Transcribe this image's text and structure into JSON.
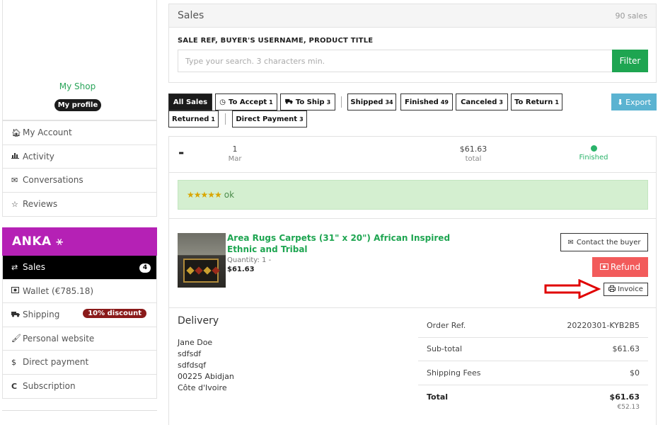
{
  "sidebar": {
    "shop_link": "My Shop",
    "profile_badge": "My profile",
    "account_items": [
      {
        "label": "My Account",
        "icon": "home-icon"
      },
      {
        "label": "Activity",
        "icon": "bar-chart-icon"
      },
      {
        "label": "Conversations",
        "icon": "envelope-icon"
      },
      {
        "label": "Reviews",
        "icon": "star-icon"
      }
    ],
    "brand": "ANKA",
    "shop_items": [
      {
        "label": "Sales",
        "icon": "exchange-icon",
        "badge": "4",
        "active": true
      },
      {
        "label": "Wallet (€785.18)",
        "icon": "wallet-icon"
      },
      {
        "label": "Shipping",
        "icon": "truck-icon",
        "badge": "10% discount"
      },
      {
        "label": "Personal website",
        "icon": "brush-icon"
      },
      {
        "label": "Direct payment",
        "icon": "dollar-icon"
      },
      {
        "label": "Subscription",
        "icon": "refresh-icon"
      }
    ]
  },
  "sales": {
    "title": "Sales",
    "count": "90 sales",
    "search_label": "SALE REF, BUYER'S USERNAME, PRODUCT TITLE",
    "search_placeholder": "Type your search. 3 characters min.",
    "filter_button": "Filter"
  },
  "filters": [
    {
      "label": "All Sales",
      "count": ""
    },
    {
      "label": "To Accept",
      "count": "1"
    },
    {
      "label": "To Ship",
      "count": "3"
    },
    {
      "label": "Shipped",
      "count": "34"
    },
    {
      "label": "Finished",
      "count": "49"
    },
    {
      "label": "Canceled",
      "count": "3"
    },
    {
      "label": "To Return",
      "count": "1"
    },
    {
      "label": "Returned",
      "count": "1"
    },
    {
      "label": "Direct Payment",
      "count": "3"
    }
  ],
  "export_button": "Export",
  "order": {
    "collapse": "-",
    "day": "1",
    "month": "Mar",
    "amount": "$61.63",
    "amount_label": "total",
    "status": "Finished",
    "status_color": "#2ab36a",
    "review_stars": "★★★★★",
    "review_text": "ok",
    "product_title": "Area Rugs Carpets (31\" x 20\") African Inspired Ethnic and Tribal",
    "quantity": "Quantity: 1 -",
    "price": "$61.63",
    "contact_button": "Contact the buyer",
    "refund_button": "Refund",
    "invoice_button": "Invoice"
  },
  "delivery": {
    "title": "Delivery",
    "address_lines": [
      "Jane Doe",
      "sdfsdf",
      "sdfdsqf",
      "00225 Abidjan",
      "Côte d'Ivoire"
    ]
  },
  "summary": {
    "order_ref_label": "Order Ref.",
    "order_ref": "20220301-KYB2B5",
    "subtotal_label": "Sub-total",
    "subtotal": "$61.63",
    "shipping_label": "Shipping Fees",
    "shipping": "$0",
    "total_label": "Total",
    "total": "$61.63",
    "total_eur": "€52.13"
  }
}
